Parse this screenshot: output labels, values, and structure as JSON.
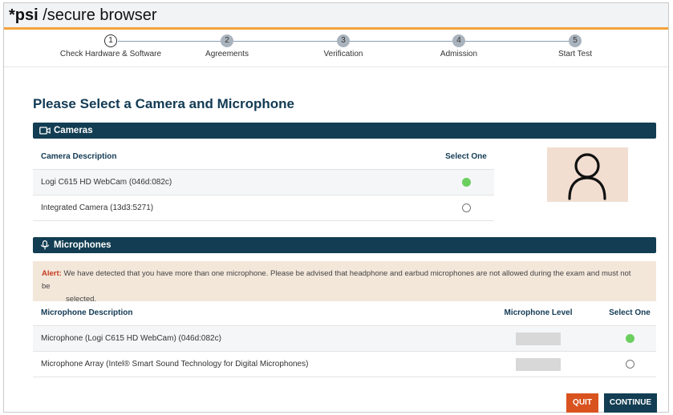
{
  "titlebar": {
    "brand_bold": "*psi",
    "brand_rest": " /secure browser"
  },
  "steps": [
    {
      "num": "1",
      "label": "Check Hardware & Software",
      "state": "active"
    },
    {
      "num": "2",
      "label": "Agreements",
      "state": "inactive"
    },
    {
      "num": "3",
      "label": "Verification",
      "state": "inactive"
    },
    {
      "num": "4",
      "label": "Admission",
      "state": "inactive"
    },
    {
      "num": "5",
      "label": "Start Test",
      "state": "inactive"
    }
  ],
  "page_title": "Please Select a Camera and Microphone",
  "cameras": {
    "section_label": "Cameras",
    "col_description": "Camera Description",
    "col_select": "Select One",
    "rows": [
      {
        "description": "Logi C615 HD WebCam (046d:082c)",
        "selected": true
      },
      {
        "description": "Integrated Camera (13d3:5271)",
        "selected": false
      }
    ]
  },
  "microphones": {
    "section_label": "Microphones",
    "alert_key": "Alert:",
    "alert_line1": "We have detected that you have more than one microphone. Please be advised that headphone and earbud microphones are not allowed during the exam and must not be",
    "alert_line2": "selected.",
    "col_description": "Microphone Description",
    "col_level": "Microphone Level",
    "col_select": "Select One",
    "rows": [
      {
        "description": "Microphone (Logi C615 HD WebCam) (046d:082c)",
        "selected": true
      },
      {
        "description": "Microphone Array (Intel® Smart Sound Technology for Digital Microphones)",
        "selected": false
      }
    ]
  },
  "buttons": {
    "quit": "QUIT",
    "continue": "CONTINUE"
  },
  "colors": {
    "accent_orange": "#f3a23a",
    "section_navy": "#123d52",
    "selected_green": "#6bcf5f",
    "quit_orange": "#d9531e",
    "alert_red": "#c63a1f"
  },
  "icons": {
    "camera": "video-camera-icon",
    "microphone": "microphone-icon",
    "preview": "user-silhouette-icon"
  }
}
